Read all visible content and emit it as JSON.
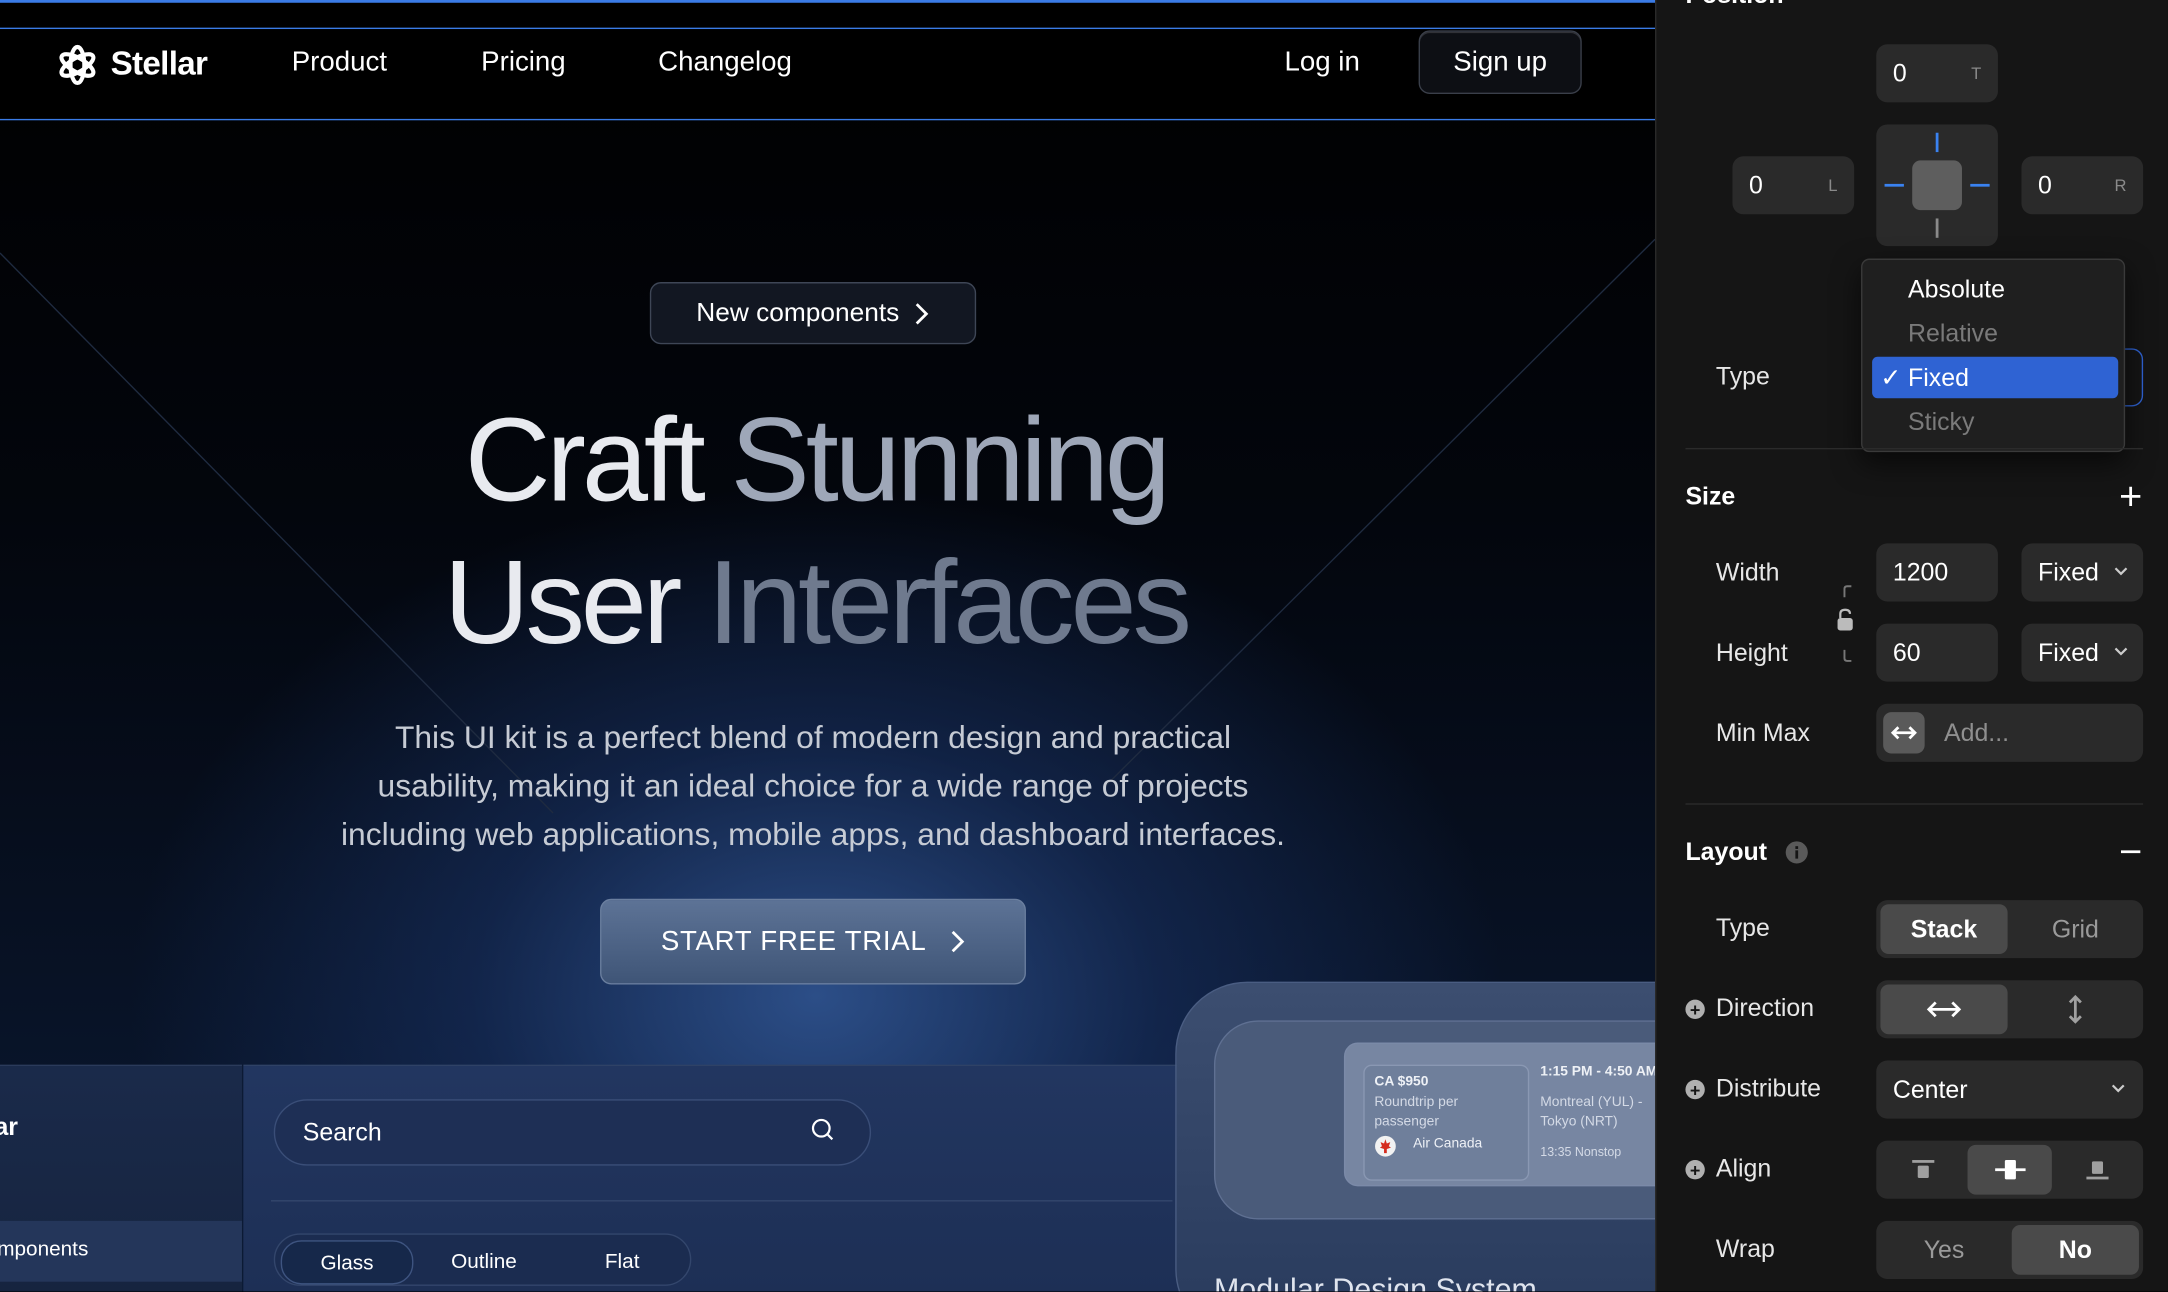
{
  "site": {
    "brand": "Stellar",
    "nav": [
      "Product",
      "Pricing",
      "Changelog"
    ],
    "login": "Log in",
    "signup": "Sign up",
    "badge": "New components",
    "title_line1_a": "Craft",
    "title_line1_b": "Stunning",
    "title_line2_a": "User",
    "title_line2_b": "Interfaces",
    "subtitle_lines": [
      "This UI kit is a perfect blend of modern design and practical",
      "usability, making it an ideal choice for a wide range of projects",
      "including web applications, mobile apps, and dashboard interfaces."
    ],
    "cta": "START FREE TRIAL",
    "preview": {
      "left_partial_title": "ar",
      "left_partial_item": "mponents",
      "search_placeholder": "Search",
      "styles": [
        "Glass",
        "Outline",
        "Flat"
      ],
      "ticket": {
        "price": "CA $950",
        "type_line1": "Roundtrip per",
        "type_line2": "passenger",
        "airline": "Air Canada",
        "time": "1:15 PM - 4:50 AM",
        "route_line1": "Montreal (YUL) -",
        "route_line2": "Tokyo (NRT)",
        "duration": "13:35 Nonstop"
      },
      "bottom_partial": "Modular Design System"
    }
  },
  "inspector": {
    "position_title": "Position",
    "offsets": {
      "top": {
        "value": "0",
        "tag": "T"
      },
      "left": {
        "value": "0",
        "tag": "L"
      },
      "right": {
        "value": "0",
        "tag": "R"
      }
    },
    "type_label": "Type",
    "type_options": [
      "Absolute",
      "Relative",
      "Fixed",
      "Sticky"
    ],
    "type_selected": "Fixed",
    "check": "✓",
    "size": {
      "title": "Size",
      "width_label": "Width",
      "width_value": "1200",
      "width_mode": "Fixed",
      "height_label": "Height",
      "height_value": "60",
      "height_mode": "Fixed",
      "minmax_label": "Min Max",
      "minmax_placeholder": "Add..."
    },
    "layout": {
      "title": "Layout",
      "type_label": "Type",
      "type_options": [
        "Stack",
        "Grid"
      ],
      "type_selected": "Stack",
      "direction_label": "Direction",
      "distribute_label": "Distribute",
      "distribute_value": "Center",
      "align_label": "Align",
      "wrap_label": "Wrap",
      "wrap_options": [
        "Yes",
        "No"
      ],
      "wrap_selected": "No"
    },
    "accent_color": "#2f63d3"
  }
}
